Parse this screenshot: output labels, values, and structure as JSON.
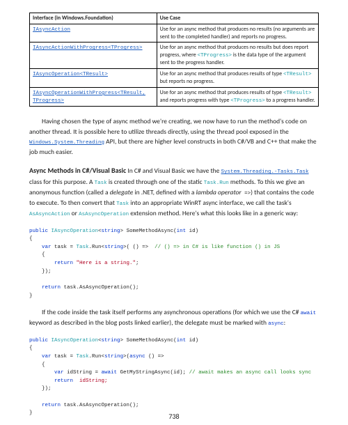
{
  "table": {
    "headers": [
      "Interface (in Windows.Foundation)",
      "Use Case"
    ],
    "rows": [
      {
        "iface": "IAsyncAction",
        "use": "Use for an async method that produces no results (no arguments are sent to the completed handler) and reports no progress."
      },
      {
        "iface": "IAsyncActionWithProgress<TProgress>",
        "use_a": "Use for an async method that produces no results but does report progress, where ",
        "use_code": "<TProgress>",
        "use_b": " is the data type of the argument sent to the progress handler."
      },
      {
        "iface": "IAsyncOperation<TResult>",
        "use_a": "Use for an async method that produces results of type ",
        "use_code": "<TResult>",
        "use_b": " but reports no progress."
      },
      {
        "iface": "IAsyncOperationWithProgress<TResult, TProgress>",
        "use_a": "Use for an async method that produces results of type ",
        "use_code1": "<TResult>",
        "use_mid": " and reports progress with type ",
        "use_code2": "<TProgress>",
        "use_b": " to a progress handler."
      }
    ]
  },
  "para1": {
    "a": "Having chosen the type of async method we're creating, we now have to run the method's code on another thread. It is possible here to utilize threads directly, using the thread pool exposed in the ",
    "link": "Windows.System.Threading",
    "b": " API, but there are higher level constructs in both C#/VB and C++ that make the job much easier."
  },
  "section": {
    "heading": "Async Methods in C#/Visual Basic",
    "intro_a": "  In C# and Visual Basic we have the ",
    "link1": "System.Threading.-Tasks.Task",
    "mid1": " class for this purpose. A ",
    "task1": "Task",
    "mid2": " is created through one of the static ",
    "taskrun": "Task.Run",
    "mid3": " methods. To this we give an anonymous function (called a ",
    "delegate": "delegate",
    "mid4": " in .NET, defined with a ",
    "lambda": "lambda operator",
    "arrow": " =>",
    "mid5": ") that contains the code to execute. To then convert that ",
    "task2": "Task",
    "mid6": " into an appropriate WinRT async interface, we call the task's ",
    "asaction": "AsAsyncAction",
    "or": " or ",
    "asop": "AsAsyncOperation",
    "mid7": " extension method. Here's what this looks like in a generic way:"
  },
  "code1": {
    "l1a": "public",
    "l1b": " IAsyncOperation",
    "l1c": "<",
    "l1d": "string",
    "l1e": "> SomeMethodAsync(",
    "l1f": "int",
    "l1g": " id)",
    "l2": "{",
    "l3a": "    var",
    "l3b": " task = ",
    "l3c": "Task",
    "l3d": ".Run<",
    "l3e": "string",
    "l3f": ">( () =>  ",
    "l3g": "// () => in C# is like function () in JS",
    "l4": "    {",
    "l5a": "        return",
    "l5b": " \"Here is a string.\"",
    "l5c": ";",
    "l6": "    });",
    "l7": "",
    "l8a": "    return",
    "l8b": " task.AsAsyncOperation();",
    "l9": "}"
  },
  "para2": {
    "a": "If the code inside the task itself performs any asynchronous operations (for which we use the C# ",
    "await": "await",
    "b": " keyword as described in the blog posts linked earlier), the delegate must be marked with ",
    "async": "async",
    "c": ":"
  },
  "code2": {
    "l1a": "public",
    "l1b": " IAsyncOperation",
    "l1c": "<",
    "l1d": "string",
    "l1e": "> SomeMethodAsync(",
    "l1f": "int",
    "l1g": " id)",
    "l2": "{",
    "l3a": "    var",
    "l3b": " task = ",
    "l3c": "Task",
    "l3d": ".Run<",
    "l3e": "string",
    "l3f": ">(",
    "l3g": "async",
    "l3h": " () =>",
    "l4": "    {",
    "l5a": "        var",
    "l5b": " idString = ",
    "l5c": "await",
    "l5d": " GetMyStringAsync(id); ",
    "l5e": "// await makes an async call looks sync",
    "l6a": "        return",
    "l6b": " idString;",
    "l7": "    });",
    "l8": "",
    "l9a": "    return",
    "l9b": " task.AsAsyncOperation();",
    "l10": "}"
  },
  "pageNumber": "738"
}
